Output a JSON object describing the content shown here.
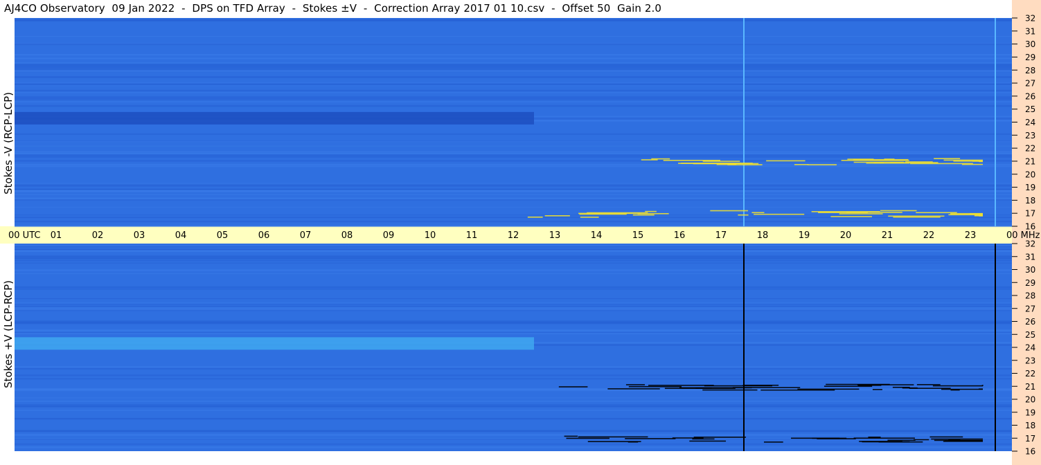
{
  "title": "AJ4CO Observatory  09 Jan 2022  -  DPS on TFD Array  -  Stokes ±V  -  Correction Array 2017 01 10.csv  -  Offset 50  Gain 2.0",
  "chart_data": [
    {
      "type": "heatmap",
      "name": "top-panel",
      "ylabel": "Stokes -V (RCP-LCP)",
      "y_ticks": [
        "32",
        "31",
        "30",
        "29",
        "28",
        "27",
        "26",
        "25",
        "24",
        "23",
        "22",
        "21",
        "20",
        "19",
        "18",
        "17",
        "16"
      ],
      "ylim": [
        16,
        32
      ],
      "x_range_utc": [
        0,
        24
      ],
      "background_color": "#2f6fe0",
      "features": [
        {
          "kind": "horizontal-band",
          "freq": 24.3,
          "x_start": 0,
          "x_end": 12.5,
          "color": "#1c4fc0"
        },
        {
          "kind": "vertical-line",
          "x": 17.55,
          "color": "#5ab8ff"
        },
        {
          "kind": "vertical-line",
          "x": 23.6,
          "color": "#5ab8ff"
        },
        {
          "kind": "emission-streaks",
          "freq": 21,
          "x_start": 13,
          "x_end": 23.3,
          "color": "#f0e030"
        },
        {
          "kind": "emission-streaks",
          "freq": 17,
          "x_start": 12.3,
          "x_end": 23.3,
          "color": "#f0e030"
        }
      ]
    },
    {
      "type": "heatmap",
      "name": "bottom-panel",
      "ylabel": "Stokes +V (LCP-RCP)",
      "y_ticks": [
        "32",
        "31",
        "30",
        "29",
        "28",
        "27",
        "26",
        "25",
        "24",
        "23",
        "22",
        "21",
        "20",
        "19",
        "18",
        "17",
        "16"
      ],
      "ylim": [
        16,
        32
      ],
      "x_range_utc": [
        0,
        24
      ],
      "background_color": "#2f6fe0",
      "features": [
        {
          "kind": "horizontal-band",
          "freq": 24.3,
          "x_start": 0,
          "x_end": 12.5,
          "color": "#3fa8f0"
        },
        {
          "kind": "vertical-line",
          "x": 17.55,
          "color": "#000000"
        },
        {
          "kind": "vertical-line",
          "x": 23.6,
          "color": "#000000"
        },
        {
          "kind": "emission-streaks",
          "freq": 21,
          "x_start": 13,
          "x_end": 23.3,
          "color": "#000000"
        },
        {
          "kind": "emission-streaks",
          "freq": 17,
          "x_start": 12.3,
          "x_end": 23.3,
          "color": "#000000"
        }
      ]
    }
  ],
  "x_axis": {
    "labels": [
      "00",
      "01",
      "02",
      "03",
      "04",
      "05",
      "06",
      "07",
      "08",
      "09",
      "10",
      "11",
      "12",
      "13",
      "14",
      "15",
      "16",
      "17",
      "18",
      "19",
      "20",
      "21",
      "22",
      "23",
      "00"
    ],
    "first_unit": "UTC",
    "last_unit": "MHz",
    "band_color": "#ffffc0"
  },
  "colors": {
    "right_strip": "#ffdcc0",
    "tick_text": "#000000"
  }
}
